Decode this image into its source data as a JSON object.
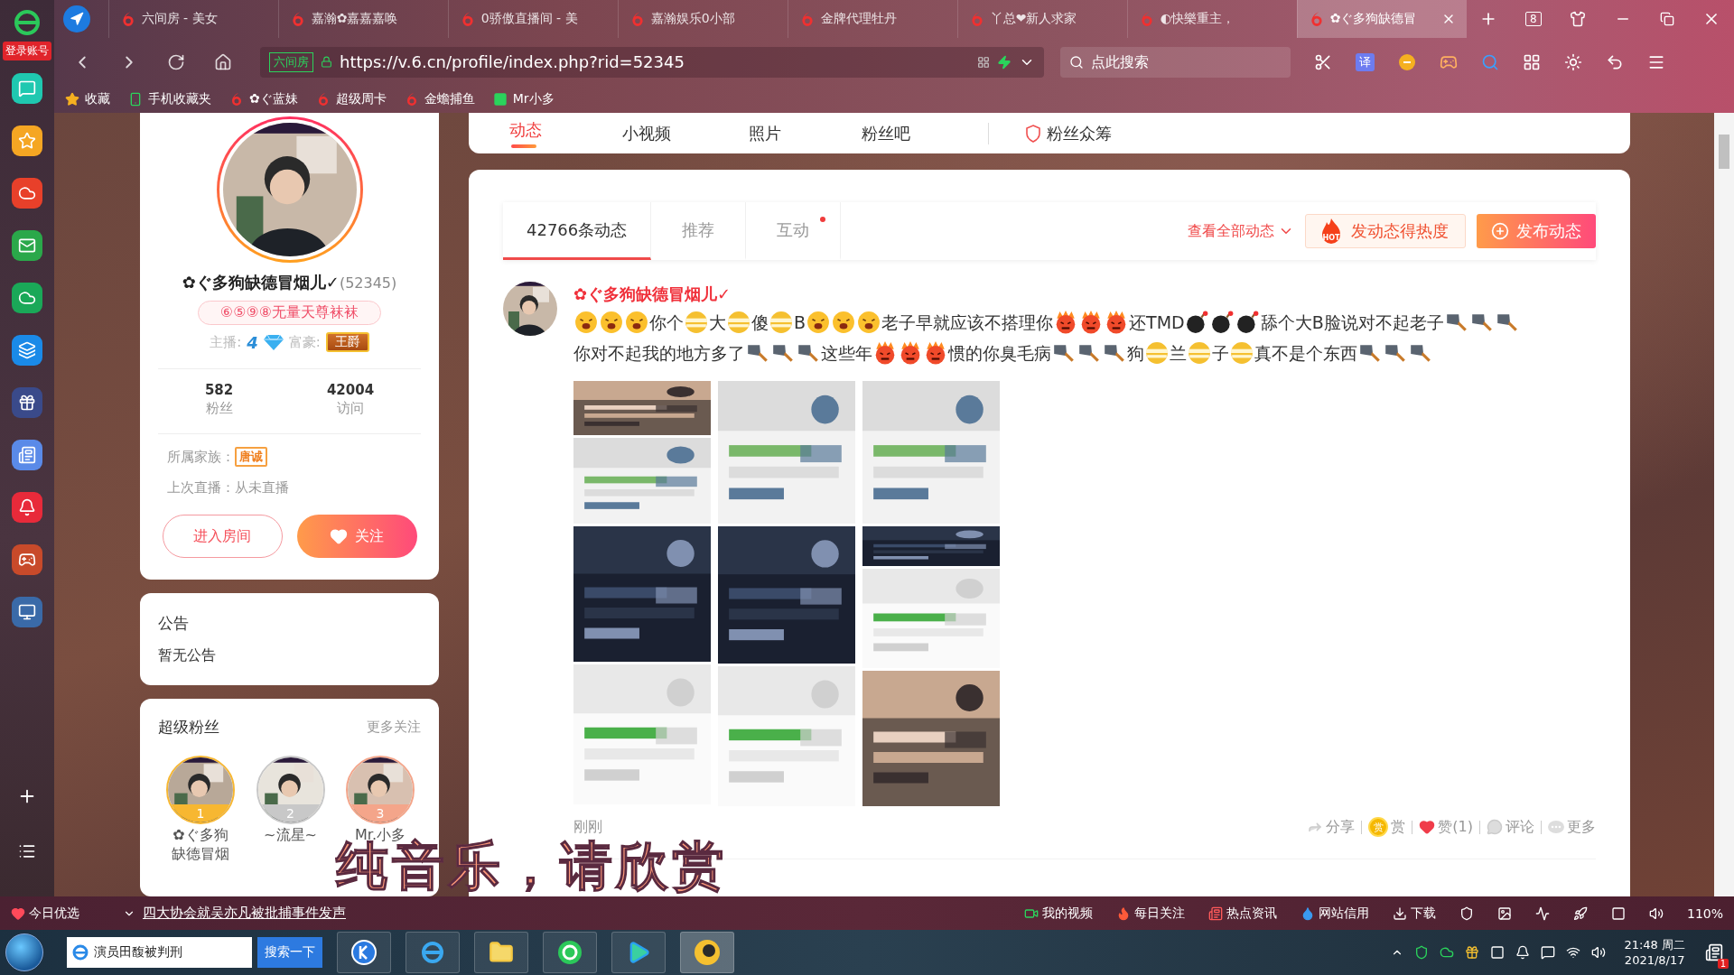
{
  "browser": {
    "login_label": "登录账号",
    "tabs": [
      {
        "title": "六间房 - 美女",
        "selected": false
      },
      {
        "title": "嘉瀚✿嘉嘉嘉唤",
        "selected": false
      },
      {
        "title": "0骄傲直播间 - 美",
        "selected": false
      },
      {
        "title": "嘉瀚娱乐0小部",
        "selected": false
      },
      {
        "title": "金牌代理牡丹",
        "selected": false
      },
      {
        "title": "丫总❤新人求家",
        "selected": false
      },
      {
        "title": "◐快樂重主，",
        "selected": false
      },
      {
        "title": "✿ぐ多狗缺德冒",
        "selected": true
      }
    ],
    "tab_count": "8",
    "address": {
      "site_label": "六间房",
      "url": "https://v.6.cn/profile/index.php?rid=52345",
      "search_placeholder": "点此搜索",
      "translate_label": "译"
    },
    "bookmarks": [
      {
        "kind": "star",
        "label": "收藏"
      },
      {
        "kind": "phone",
        "label": "手机收藏夹"
      },
      {
        "kind": "six",
        "label": "✿ぐ蓝妹"
      },
      {
        "kind": "six",
        "label": "超级周卡"
      },
      {
        "kind": "six",
        "label": "金蟾捕鱼"
      },
      {
        "kind": "app",
        "label": "Mr小多"
      }
    ]
  },
  "profile": {
    "name": "✿ぐ多狗缺德冒烟儿✓",
    "room_id": "(52345)",
    "title_badge": "⑥⑤⑨⑧无量天尊袜袜",
    "anchor_label": "主播:",
    "anchor_level": "4",
    "rich_label": "富豪:",
    "rich_badge": "王爵",
    "stats": [
      {
        "value": "582",
        "label": "粉丝"
      },
      {
        "value": "42004",
        "label": "访问"
      }
    ],
    "family_label": "所属家族：",
    "family_badge": "唐诚",
    "last_live": "上次直播：从未直播",
    "enter_button": "进入房间",
    "follow_button": "关注"
  },
  "announcement": {
    "title": "公告",
    "text": "暂无公告"
  },
  "super_fans": {
    "title": "超级粉丝",
    "more": "更多关注",
    "fans": [
      {
        "rank": "1",
        "name": "✿ぐ多狗缺德冒烟",
        "color": "#f7b731"
      },
      {
        "rank": "2",
        "name": "~流星~",
        "color": "#c8c8c8"
      },
      {
        "rank": "3",
        "name": "Mr.小多",
        "color": "#f4a58a"
      }
    ]
  },
  "nav_tabs": [
    {
      "label": "动态",
      "selected": true
    },
    {
      "label": "小视频",
      "selected": false
    },
    {
      "label": "照片",
      "selected": false
    },
    {
      "label": "粉丝吧",
      "selected": false
    },
    {
      "label": "粉丝众筹",
      "selected": false
    }
  ],
  "feed": {
    "tabs": [
      {
        "label": "42766条动态",
        "selected": true,
        "dot": false
      },
      {
        "label": "推荐",
        "selected": false,
        "dot": false
      },
      {
        "label": "互动",
        "selected": false,
        "dot": true
      }
    ],
    "view_all": "查看全部动态",
    "hot_badge": "HOT",
    "hot_button": "发动态得热度",
    "publish_button": "发布动态",
    "post": {
      "author": "✿ぐ多狗缺德冒烟儿✓",
      "segments": [
        {
          "kind": "tired"
        },
        {
          "kind": "tired"
        },
        {
          "kind": "tired"
        },
        {
          "kind": "text",
          "text": "你个"
        },
        {
          "kind": "bandaged"
        },
        {
          "kind": "text",
          "text": "大"
        },
        {
          "kind": "bandaged"
        },
        {
          "kind": "text",
          "text": "傻"
        },
        {
          "kind": "bandaged"
        },
        {
          "kind": "text",
          "text": "B"
        },
        {
          "kind": "tired"
        },
        {
          "kind": "tired"
        },
        {
          "kind": "tired"
        },
        {
          "kind": "text",
          "text": "老子早就应该不搭理你"
        },
        {
          "kind": "angry"
        },
        {
          "kind": "angry"
        },
        {
          "kind": "angry"
        },
        {
          "kind": "text",
          "text": "还TMD"
        },
        {
          "kind": "bomb"
        },
        {
          "kind": "bomb"
        },
        {
          "kind": "bomb"
        },
        {
          "kind": "text",
          "text": "舔个大B脸说对不起老子"
        },
        {
          "kind": "cleaver"
        },
        {
          "kind": "cleaver"
        },
        {
          "kind": "cleaver"
        },
        {
          "kind": "text",
          "text": "你对不起我的地方多了"
        },
        {
          "kind": "cleaver"
        },
        {
          "kind": "cleaver"
        },
        {
          "kind": "cleaver"
        },
        {
          "kind": "text",
          "text": "这些年"
        },
        {
          "kind": "angry"
        },
        {
          "kind": "angry"
        },
        {
          "kind": "angry"
        },
        {
          "kind": "text",
          "text": "惯的你臭毛病"
        },
        {
          "kind": "cleaver"
        },
        {
          "kind": "cleaver"
        },
        {
          "kind": "cleaver"
        },
        {
          "kind": "text",
          "text": "狗"
        },
        {
          "kind": "bandaged"
        },
        {
          "kind": "text",
          "text": "兰"
        },
        {
          "kind": "bandaged"
        },
        {
          "kind": "text",
          "text": "子"
        },
        {
          "kind": "bandaged"
        },
        {
          "kind": "text",
          "text": "真不是个东西"
        },
        {
          "kind": "cleaver"
        },
        {
          "kind": "cleaver"
        },
        {
          "kind": "cleaver"
        }
      ],
      "time": "刚刚",
      "actions": [
        {
          "kind": "share",
          "label": "分享"
        },
        {
          "kind": "reward",
          "label": "赏",
          "badge": "赏"
        },
        {
          "kind": "like",
          "label": "赞(1)"
        },
        {
          "kind": "comment",
          "label": "评论"
        },
        {
          "kind": "more",
          "label": "更多"
        }
      ]
    }
  },
  "status_bar": {
    "today": "今日优选",
    "headline": "四大协会就吴亦凡被批捕事件发声",
    "items": [
      {
        "kind": "video",
        "label": "我的视频"
      },
      {
        "kind": "fire",
        "label": "每日关注"
      },
      {
        "kind": "news",
        "label": "热点资讯"
      },
      {
        "kind": "drop",
        "label": "网站信用"
      },
      {
        "kind": "download",
        "label": "下载"
      }
    ],
    "zoom": "110%"
  },
  "taskbar": {
    "search_value": "演员田馥被判刑",
    "search_button": "搜索一下",
    "time": "21:48 周二",
    "date": "2021/8/17",
    "notification_count": "1"
  },
  "subtitle": "纯音乐，请欣赏"
}
